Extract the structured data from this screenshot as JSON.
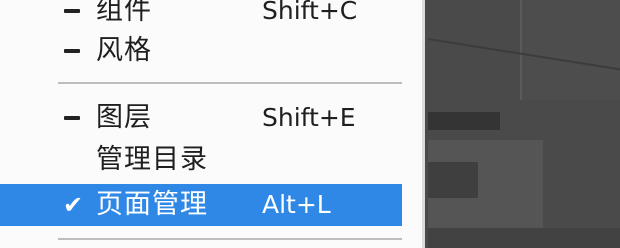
{
  "menu": {
    "items": [
      {
        "label": "组件",
        "shortcut": "Shift+C",
        "mark": "dash"
      },
      {
        "label": "风格",
        "shortcut": "",
        "mark": "dash"
      },
      {
        "label": "图层",
        "shortcut": "Shift+E",
        "mark": "dash"
      },
      {
        "label": "管理目录",
        "shortcut": "",
        "mark": "none"
      },
      {
        "label": "页面管理",
        "shortcut": "Alt+L",
        "mark": "check",
        "selected": true
      }
    ],
    "check_glyph": "✔"
  },
  "colors": {
    "selection": "#2f88e6",
    "menu_background": "#fbfbfb",
    "separator": "#bdbdbd"
  }
}
